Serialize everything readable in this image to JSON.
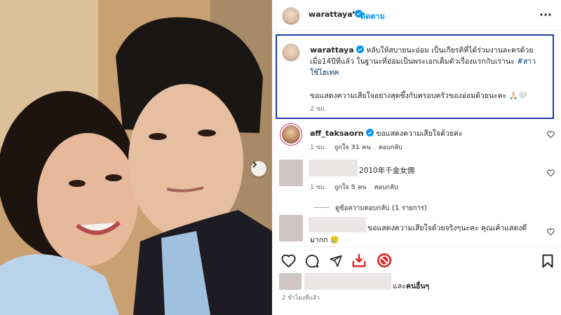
{
  "post": {
    "username": "warattaya",
    "follow_label": "ติดตาม",
    "dot": "•"
  },
  "caption": {
    "username": "warattaya",
    "text": "หลับให้สบายนะอ่อม เป็นเกียรติที่ได้ร่วมงานละครด้วยเมื่อ14ปีที่แล้ว ในฐานะที่อ่อมเป็นพระเอกเต็มตัวเรื่องแรกกับเรานะ",
    "hashtag": "#สาวใช้ไฮเทค",
    "line2": "ขอแสดงความเสียใจอย่างสุดซึ้งกับครอบครัวของอ่อมด้วยนะคะ 🙏🏻🤍",
    "time": "2 ชม."
  },
  "comments": [
    {
      "username": "aff_taksaorn",
      "text": "ขอแสดงความเสียใจด้วยค่ะ",
      "time": "1 ชม.",
      "likes": "ถูกใจ 31 คน",
      "reply": "ตอบกลับ"
    },
    {
      "username": "",
      "text": "2010年千金女佣",
      "time": "1 ชม.",
      "likes": "ถูกใจ 5 คน",
      "reply": "ตอบกลับ"
    },
    {
      "username": "",
      "text": "ขอแสดงความเสียใจด้วยจริงๆนะคะ คุณเค้าแสดงดีมากก 🥲",
      "time": "",
      "likes": "",
      "reply": ""
    }
  ],
  "view_replies": "ดูข้อความตอบกลับ (1 รายการ)",
  "likes_summary": {
    "suffix_prefix": "และ",
    "suffix_bold": "คนอื่นๆ"
  },
  "time_ago": "2 ชั่วโมงที่แล้ว",
  "colors": {
    "accent": "#0095f6",
    "highlight_border": "#1f3aa8",
    "save_red": "#e02424"
  },
  "icons": [
    "more-icon",
    "heart-icon",
    "comment-icon",
    "share-icon",
    "download-icon",
    "block-icon",
    "bookmark-icon",
    "verified-badge-icon",
    "chevron-right-icon"
  ]
}
